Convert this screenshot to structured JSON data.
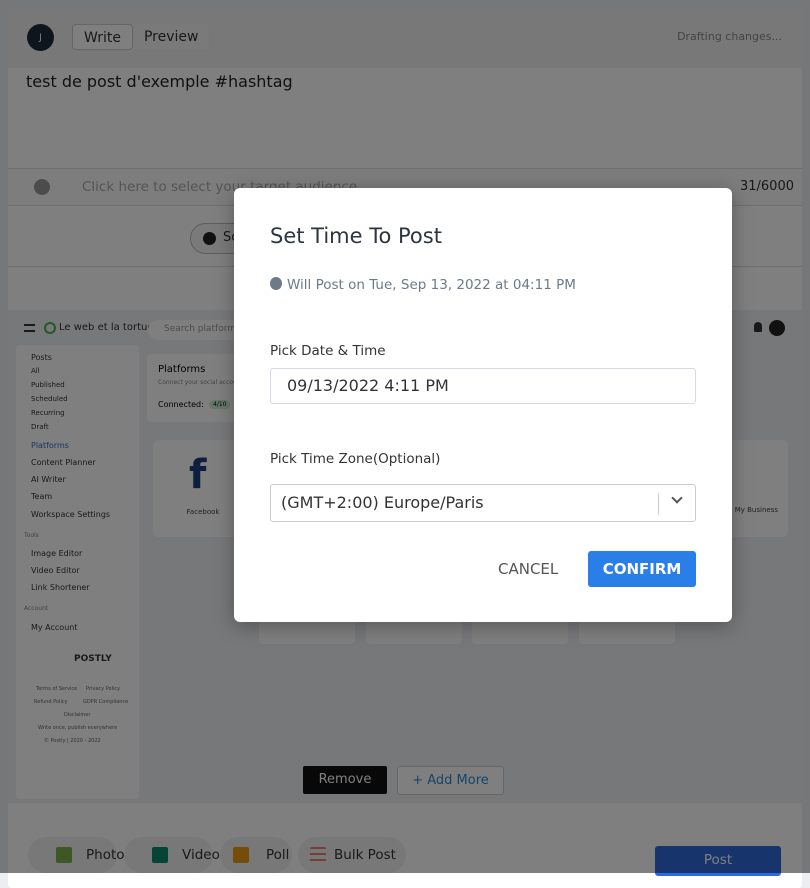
{
  "header": {
    "avatar": "J",
    "tabs": [
      "Write",
      "Preview"
    ],
    "status": "Drafting changes..."
  },
  "post_text": "test de post d'exemple #hashtag",
  "audience": {
    "placeholder": "Click here to select your target audience",
    "count": "31/6000"
  },
  "schedule_label": "Schedule",
  "embedded": {
    "workspace": "Le web et la tortue",
    "search_placeholder": "Search platforms",
    "sidebar": {
      "posts": "Posts",
      "sub": [
        "All",
        "Published",
        "Scheduled",
        "Recurring",
        "Draft"
      ],
      "items": [
        "Platforms",
        "Content Planner",
        "AI Writer",
        "Team",
        "Workspace Settings"
      ],
      "tools_label": "Tools",
      "tools": [
        "Image Editor",
        "Video Editor",
        "Link Shortener"
      ],
      "account_label": "Account",
      "account": [
        "My Account"
      ],
      "logo": "POSTLY",
      "links": [
        "Terms of Service",
        "Privacy Policy",
        "Refund Policy",
        "GDPR Compliance",
        "Disclaimer"
      ],
      "tagline": "Write once, publish everywhere",
      "copyright": "© Postly | 2020 - 2022"
    },
    "platforms_title": "Platforms",
    "platforms_sub": "Connect your social accounts",
    "connected_label": "Connected:",
    "connected_badge": "4/10",
    "cards": [
      "Facebook",
      "Google My Business"
    ],
    "remove": "Remove",
    "add_more": "+ Add More"
  },
  "bottom": {
    "buttons": [
      "Photo",
      "Video",
      "Poll",
      "Bulk Post"
    ],
    "post": "Post"
  },
  "modal": {
    "title": "Set Time To Post",
    "will_post": "Will Post on Tue, Sep 13, 2022 at 04:11 PM",
    "date_label": "Pick Date & Time",
    "date_value": "09/13/2022 4:11 PM",
    "tz_label": "Pick Time Zone(Optional)",
    "tz_value": "(GMT+2:00) Europe/Paris",
    "cancel": "CANCEL",
    "confirm": "CONFIRM"
  },
  "colors": {
    "accent": "#2a7ee8",
    "post_button": "#2e6ad8",
    "overlay": "rgba(0,0,0,0.5)"
  }
}
